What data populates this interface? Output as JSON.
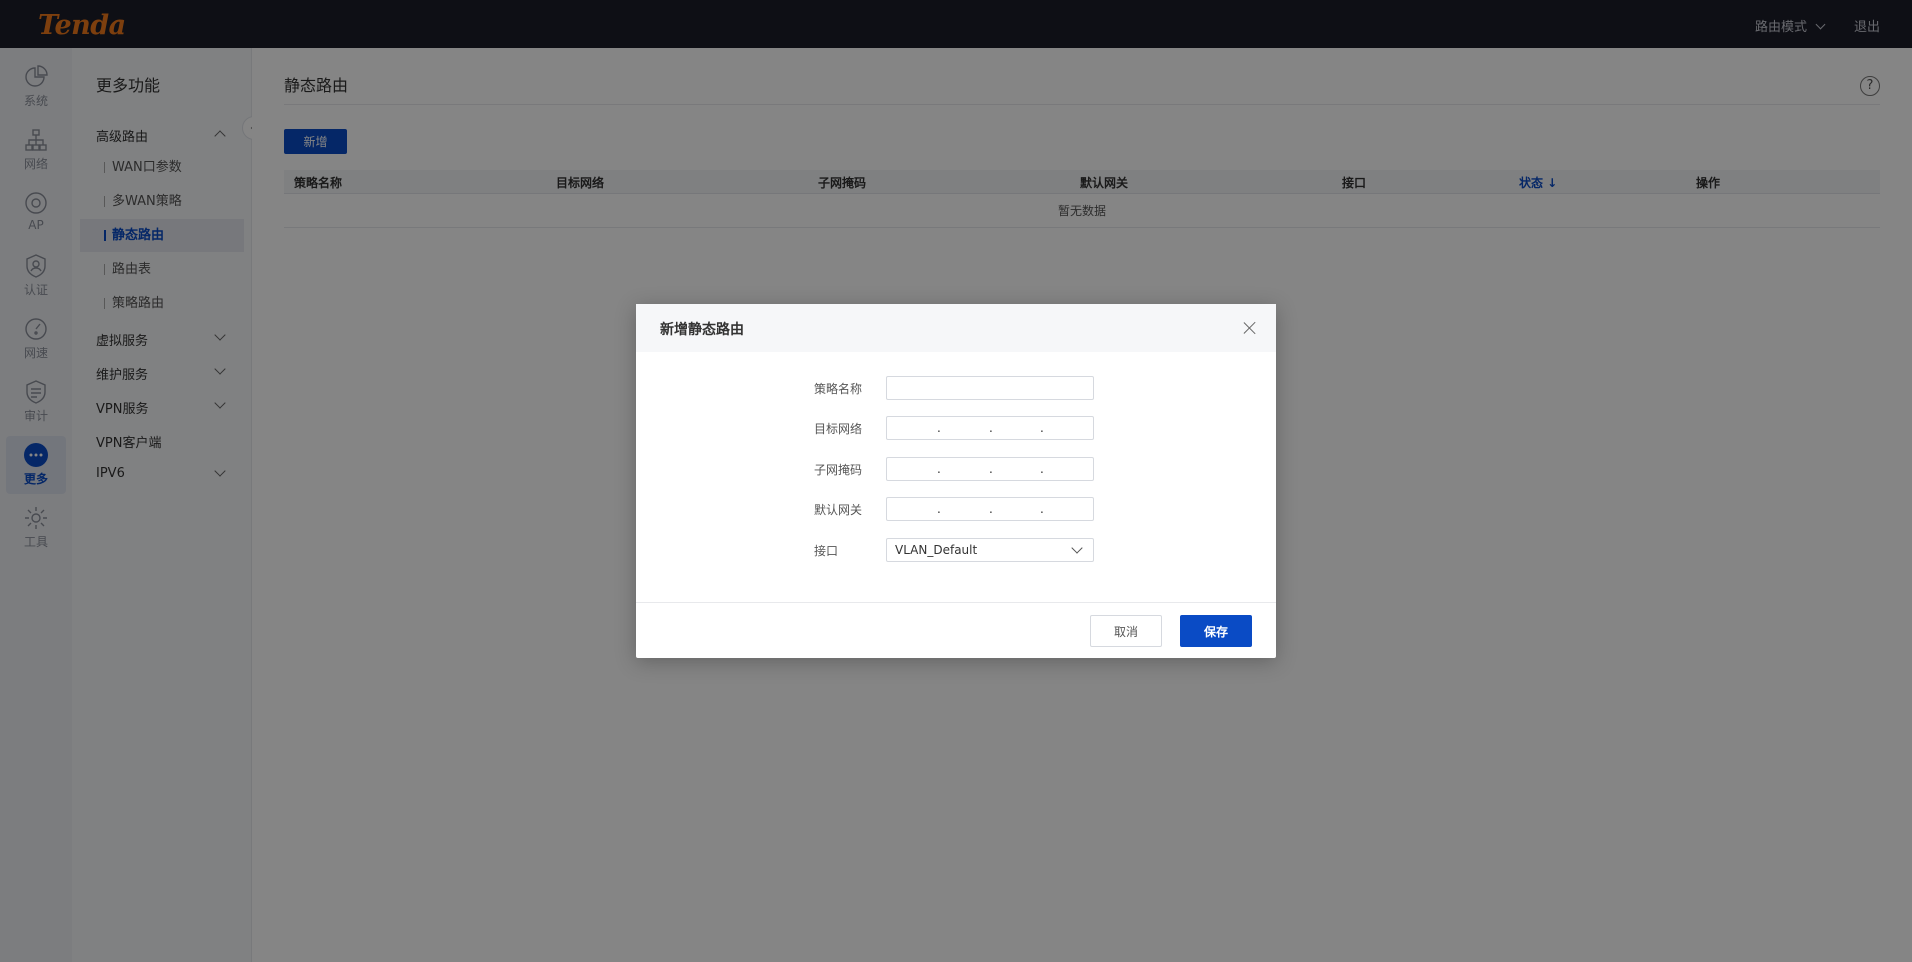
{
  "header": {
    "logo": "Tenda",
    "mode_label": "路由模式",
    "logout_label": "退出"
  },
  "rail": [
    {
      "label": "系统",
      "icon": "pie-chart-icon"
    },
    {
      "label": "网络",
      "icon": "network-topology-icon"
    },
    {
      "label": "AP",
      "icon": "ap-icon"
    },
    {
      "label": "认证",
      "icon": "auth-shield-icon"
    },
    {
      "label": "网速",
      "icon": "speed-gauge-icon"
    },
    {
      "label": "审计",
      "icon": "audit-shield-icon"
    },
    {
      "label": "更多",
      "icon": "more-dots-icon",
      "active": true
    },
    {
      "label": "工具",
      "icon": "gear-icon"
    }
  ],
  "sidebar": {
    "title": "更多功能",
    "groups": [
      {
        "label": "高级路由",
        "expanded": true
      },
      {
        "label": "虚拟服务"
      },
      {
        "label": "维护服务"
      },
      {
        "label": "VPN服务"
      },
      {
        "label": "VPN客户端"
      },
      {
        "label": "IPV6"
      }
    ],
    "items": [
      {
        "label": "WAN口参数"
      },
      {
        "label": "多WAN策略"
      },
      {
        "label": "静态路由",
        "active": true
      },
      {
        "label": "路由表"
      },
      {
        "label": "策略路由"
      }
    ]
  },
  "main": {
    "title": "静态路由",
    "help_icon": "?",
    "add_label": "新增",
    "columns": [
      "策略名称",
      "目标网络",
      "子网掩码",
      "默认网关",
      "接口",
      "状态 ↓",
      "操作"
    ],
    "sorted_column": "状态 ↓",
    "empty_text": "暂无数据"
  },
  "modal": {
    "title": "新增静态路由",
    "fields": {
      "name_label": "策略名称",
      "name_value": "",
      "dest_label": "目标网络",
      "mask_label": "子网掩码",
      "gateway_label": "默认网关",
      "iface_label": "接口",
      "iface_value": "VLAN_Default"
    },
    "cancel_label": "取消",
    "save_label": "保存"
  },
  "colors": {
    "brand_orange": "#f07a1b",
    "primary_blue": "#0a4bc5",
    "topbar": "#1b1d29"
  }
}
